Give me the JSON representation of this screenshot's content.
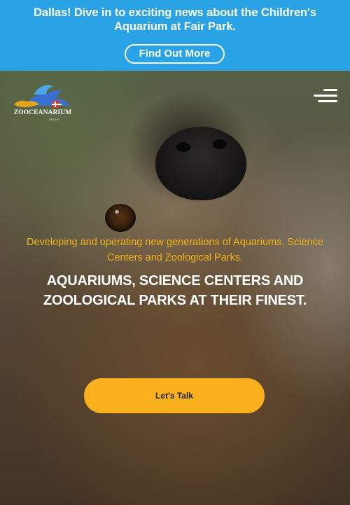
{
  "banner": {
    "text": "Dallas! Dive in to exciting news about the Children's Aquarium at Fair Park.",
    "button_label": "Find Out More",
    "background_color": "#29a3e6"
  },
  "header": {
    "logo_text": "ZOOCEANARIUM",
    "logo_subtext": "GROUP",
    "menu_icon": "hamburger-menu-icon"
  },
  "hero": {
    "tagline": "Developing and operating new generations of Aquariums, Science Centers and Zoological Parks.",
    "headline": "AQUARIUMS, SCIENCE CENTERS AND ZOOLOGICAL PARKS AT THEIR FINEST.",
    "cta_label": "Let's Talk",
    "tagline_color": "#f2b31e",
    "cta_color": "#fbb01e",
    "background_image": "sloth-photo"
  }
}
